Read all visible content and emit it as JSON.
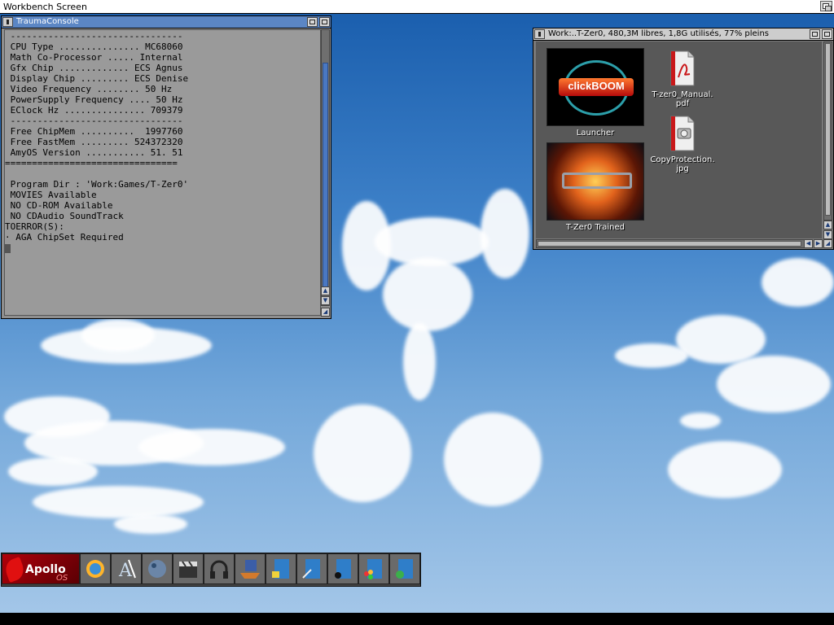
{
  "screen": {
    "title": "Workbench Screen"
  },
  "console": {
    "title": "TraumaConsole",
    "lines": [
      " --------------------------------",
      " CPU Type ............... MC68060",
      " Math Co-Processor ..... Internal",
      " Gfx Chip ............. ECS Agnus",
      " Display Chip ......... ECS Denise",
      " Video Frequency ........ 50 Hz",
      " PowerSupply Frequency .... 50 Hz",
      " EClock Hz ............... 709379",
      " --------------------------------",
      " Free ChipMem ..........  1997760",
      " Free FastMem ......... 524372320",
      " AmyOS Version ........... 51. 51",
      "================================",
      "",
      " Program Dir : 'Work:Games/T-Zer0'",
      " MOVIES Available",
      " NO CD-ROM Available",
      " NO CDAudio SoundTrack",
      "TOERROR(S):",
      "· AGA ChipSet Required"
    ]
  },
  "drawer": {
    "title": "Work:..T-Zer0,  480,3M libres, 1,8G utilisés, 77% pleins",
    "icons": [
      {
        "label": "Launcher",
        "image_text": "clickBOOM"
      },
      {
        "label": "T-Zer0 Trained"
      },
      {
        "label": "T-zer0_Manual.\npdf"
      },
      {
        "label": "CopyProtection.\njpg"
      }
    ]
  },
  "dock": {
    "apollo": {
      "name": "Apollo",
      "os": "OS"
    },
    "icons": [
      "sun-globe-icon",
      "text-editor-icon",
      "planet-icon",
      "clapperboard-icon",
      "headphones-icon",
      "disk-tray-icon",
      "drawer-disk-icon",
      "drawer-tools-icon",
      "drawer-music-icon",
      "drawer-apps-icon",
      "drawer-globe-icon"
    ]
  },
  "colors": {
    "console_title": "#5b86c4",
    "console_bg": "#9a9a9a",
    "drawer_bg": "#585858",
    "sky_top": "#1b5fae"
  }
}
